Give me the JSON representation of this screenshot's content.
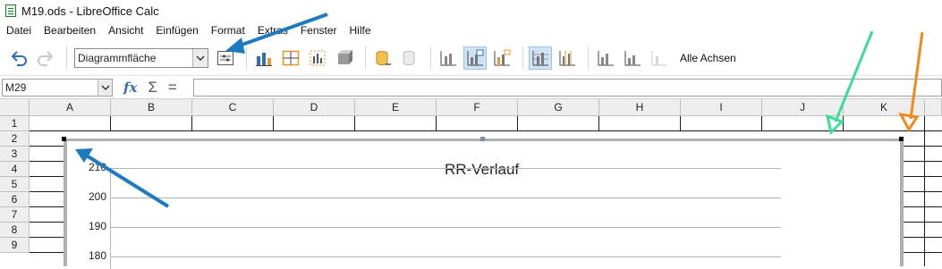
{
  "window": {
    "title": "M19.ods - LibreOffice Calc",
    "app_icon": "calc-spreadsheet-icon"
  },
  "menubar": {
    "items": [
      {
        "label": "Datei"
      },
      {
        "label": "Bearbeiten"
      },
      {
        "label": "Ansicht"
      },
      {
        "label": "Einfügen"
      },
      {
        "label": "Format"
      },
      {
        "label": "Extras"
      },
      {
        "label": "Fenster"
      },
      {
        "label": "Hilfe"
      }
    ]
  },
  "toolbar": {
    "element_select": {
      "value": "Diagrammfläche"
    },
    "all_axes_label": "Alle Achsen"
  },
  "formula_bar": {
    "cell_reference": "M29",
    "fx_label": "fx",
    "sum_symbol": "Σ",
    "equals_symbol": "=",
    "content": ""
  },
  "sheet": {
    "columns": [
      "A",
      "B",
      "C",
      "D",
      "E",
      "F",
      "G",
      "H",
      "I",
      "J",
      "K"
    ],
    "rows": [
      "1",
      "2",
      "3",
      "4",
      "5",
      "6",
      "7",
      "8",
      "9"
    ]
  },
  "chart": {
    "title": "RR-Verlauf",
    "y_ticks": [
      "210",
      "200",
      "190",
      "180"
    ]
  },
  "annotation_colors": {
    "blue": "#1f7bbf",
    "green": "#3ddc97",
    "orange": "#f08a1c"
  }
}
